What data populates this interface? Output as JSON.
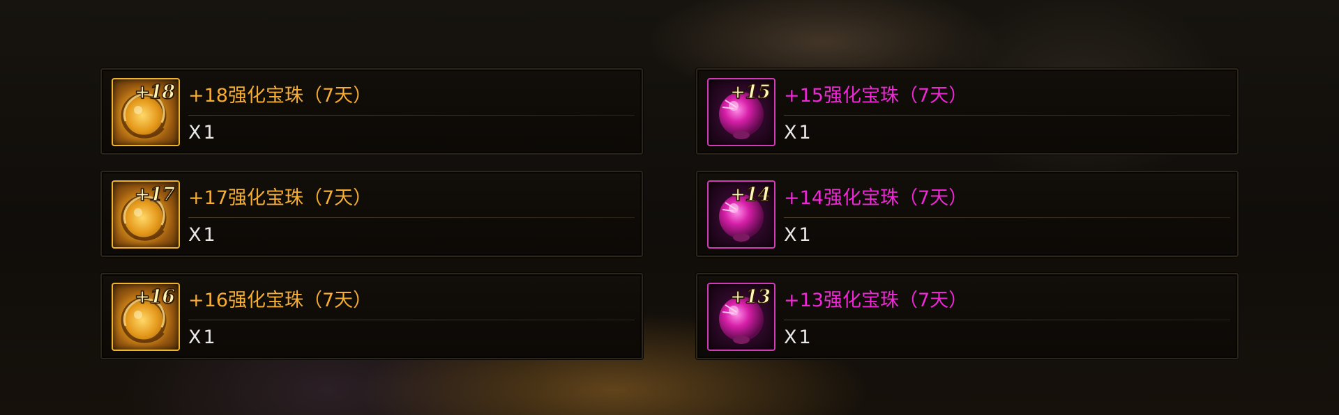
{
  "colors": {
    "gold_text": "#f6ad33",
    "pink_text": "#ee28d6",
    "quantity_text": "#e9e9e9"
  },
  "rewards": [
    {
      "level": "+18",
      "name": "+18强化宝珠（7天）",
      "quantity": "X1",
      "rarity": "gold",
      "icon": "gold-enhancement-orb-icon"
    },
    {
      "level": "+17",
      "name": "+17强化宝珠（7天）",
      "quantity": "X1",
      "rarity": "gold",
      "icon": "gold-enhancement-orb-icon"
    },
    {
      "level": "+16",
      "name": "+16强化宝珠（7天）",
      "quantity": "X1",
      "rarity": "gold",
      "icon": "gold-enhancement-orb-icon"
    },
    {
      "level": "+15",
      "name": "+15强化宝珠（7天）",
      "quantity": "X1",
      "rarity": "pink",
      "icon": "pink-enhancement-orb-icon"
    },
    {
      "level": "+14",
      "name": "+14强化宝珠（7天）",
      "quantity": "X1",
      "rarity": "pink",
      "icon": "pink-enhancement-orb-icon"
    },
    {
      "level": "+13",
      "name": "+13强化宝珠（7天）",
      "quantity": "X1",
      "rarity": "pink",
      "icon": "pink-enhancement-orb-icon"
    }
  ]
}
